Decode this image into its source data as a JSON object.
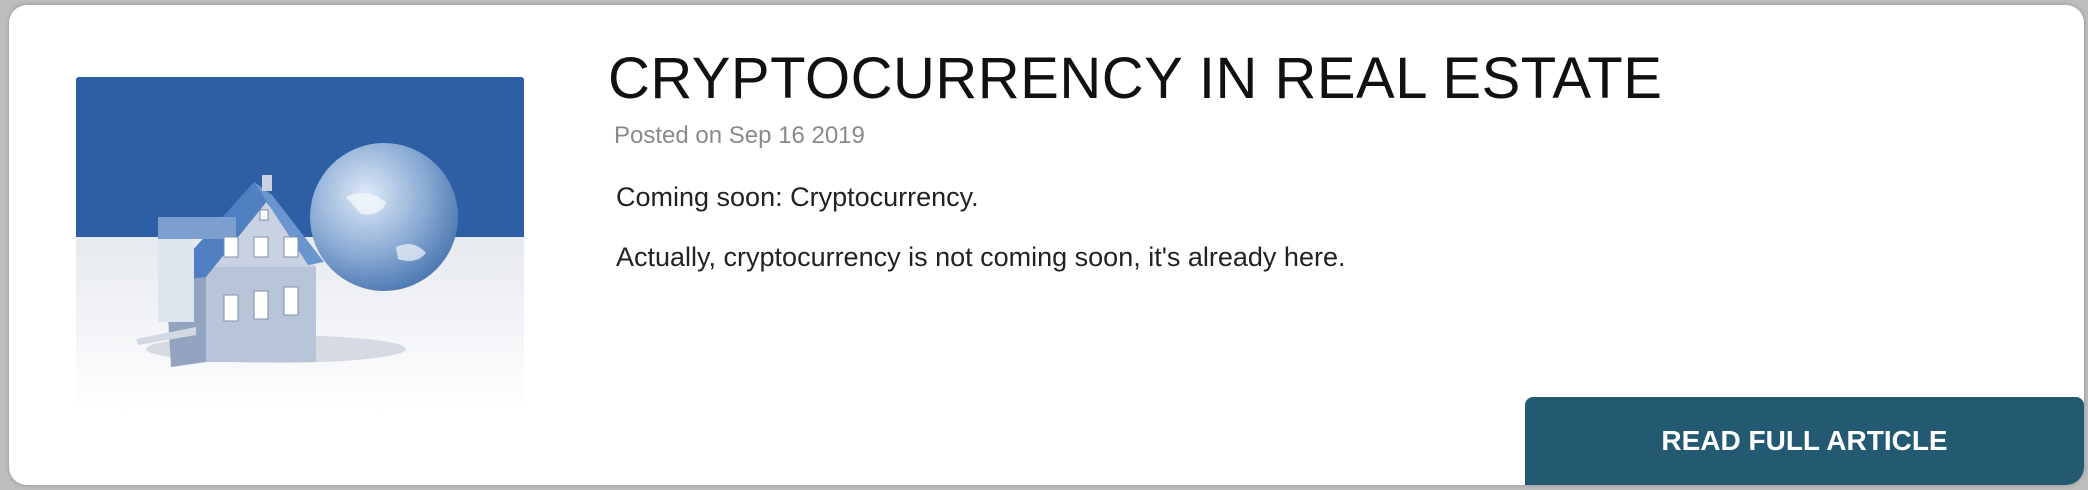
{
  "article": {
    "title": "CRYPTOCURRENCY IN REAL ESTATE",
    "posted": "Posted on Sep 16 2019",
    "paragraphs": [
      "Coming soon: Cryptocurrency.",
      "Actually, cryptocurrency is not coming soon, it's already here."
    ],
    "read_more_label": "READ FULL ARTICLE",
    "image_subject": "house-and-globe-illustration"
  },
  "colors": {
    "button_bg": "#235a71",
    "image_sky": "#2e5ea3",
    "title_text": "#111111",
    "date_text": "#8a8a8a"
  }
}
